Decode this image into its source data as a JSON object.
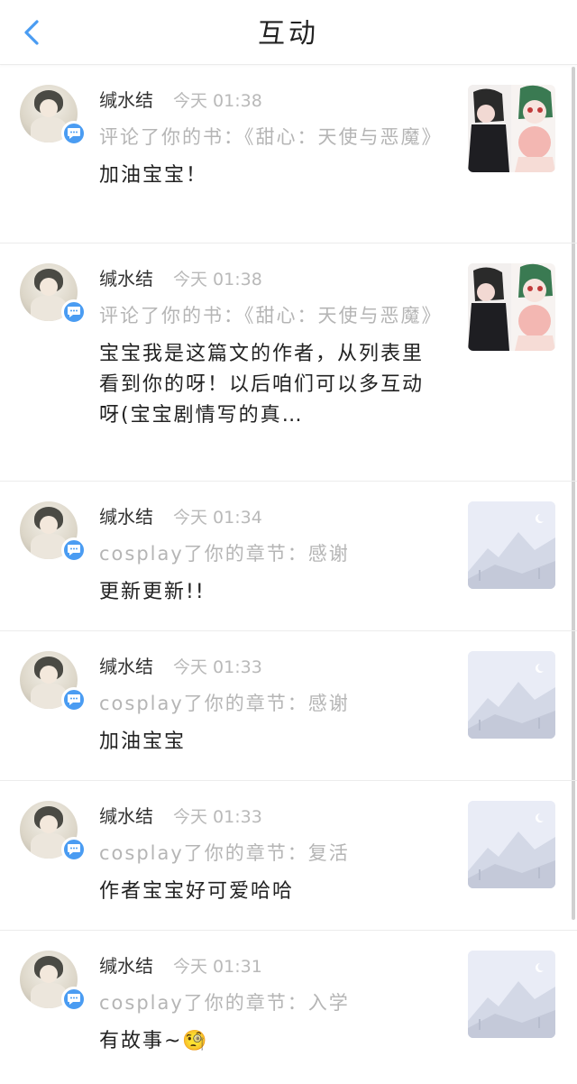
{
  "header": {
    "title": "互动"
  },
  "items": [
    {
      "username": "缄水结",
      "time": "今天 01:38",
      "action": "评论了你的书：《甜心：天使与恶魔》",
      "comment": "加油宝宝！",
      "thumb": "cover"
    },
    {
      "username": "缄水结",
      "time": "今天 01:38",
      "action": "评论了你的书：《甜心：天使与恶魔》",
      "comment": "宝宝我是这篇文的作者，从列表里看到你的呀！以后咱们可以多互动呀(宝宝剧情写的真…",
      "thumb": "cover"
    },
    {
      "username": "缄水结",
      "time": "今天 01:34",
      "action": "cosplay了你的章节：感谢",
      "comment": "更新更新!!",
      "thumb": "placeholder"
    },
    {
      "username": "缄水结",
      "time": "今天 01:33",
      "action": "cosplay了你的章节：感谢",
      "comment": "加油宝宝",
      "thumb": "placeholder"
    },
    {
      "username": "缄水结",
      "time": "今天 01:33",
      "action": "cosplay了你的章节：复活",
      "comment": "作者宝宝好可爱哈哈",
      "thumb": "placeholder"
    },
    {
      "username": "缄水结",
      "time": "今天 01:31",
      "action": "cosplay了你的章节：入学",
      "comment": "有故事~🧐",
      "thumb": "placeholder"
    }
  ],
  "icons": {
    "back": "chevron-left-icon",
    "badge": "comment-bubble-icon",
    "placeholder": "image-placeholder-icon"
  },
  "colors": {
    "accent": "#4a9cf2",
    "badge": "#4a9cf2",
    "muted_text": "#b5b5b5",
    "divider": "#ececec"
  }
}
